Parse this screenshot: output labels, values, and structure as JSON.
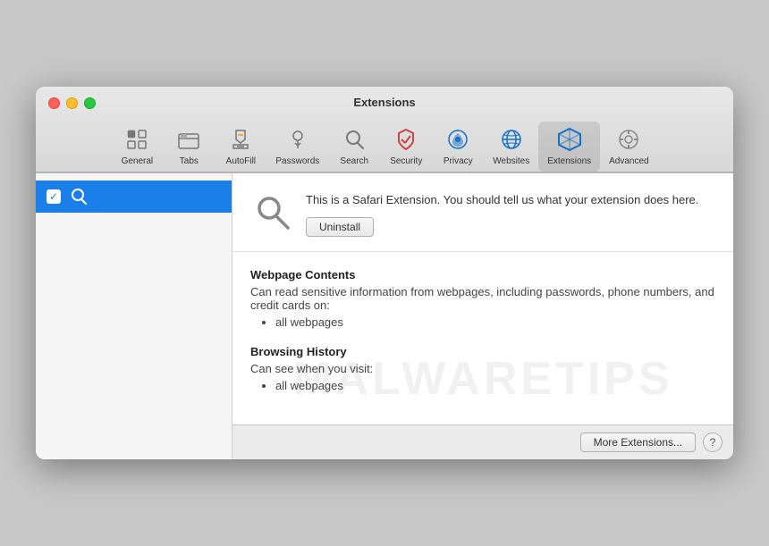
{
  "window": {
    "title": "Extensions"
  },
  "toolbar": {
    "items": [
      {
        "id": "general",
        "label": "General",
        "icon": "general"
      },
      {
        "id": "tabs",
        "label": "Tabs",
        "icon": "tabs"
      },
      {
        "id": "autofill",
        "label": "AutoFill",
        "icon": "autofill"
      },
      {
        "id": "passwords",
        "label": "Passwords",
        "icon": "passwords"
      },
      {
        "id": "search",
        "label": "Search",
        "icon": "search"
      },
      {
        "id": "security",
        "label": "Security",
        "icon": "security"
      },
      {
        "id": "privacy",
        "label": "Privacy",
        "icon": "privacy"
      },
      {
        "id": "websites",
        "label": "Websites",
        "icon": "websites"
      },
      {
        "id": "extensions",
        "label": "Extensions",
        "icon": "extensions"
      },
      {
        "id": "advanced",
        "label": "Advanced",
        "icon": "advanced"
      }
    ]
  },
  "sidebar": {
    "items": [
      {
        "id": "search-ext",
        "label": "",
        "checked": true
      }
    ]
  },
  "extension": {
    "description": "This is a Safari Extension. You should tell us what your extension does here.",
    "uninstall_label": "Uninstall"
  },
  "permissions": {
    "sections": [
      {
        "title": "Webpage Contents",
        "description": "Can read sensitive information from webpages, including passwords, phone numbers, and credit cards on:",
        "items": [
          "all webpages"
        ]
      },
      {
        "title": "Browsing History",
        "description": "Can see when you visit:",
        "items": [
          "all webpages"
        ]
      }
    ]
  },
  "footer": {
    "more_extensions_label": "More Extensions...",
    "help_label": "?"
  },
  "watermark": {
    "text": "MALWARETIPS"
  },
  "traffic_lights": {
    "close": "close",
    "minimize": "minimize",
    "maximize": "maximize"
  }
}
